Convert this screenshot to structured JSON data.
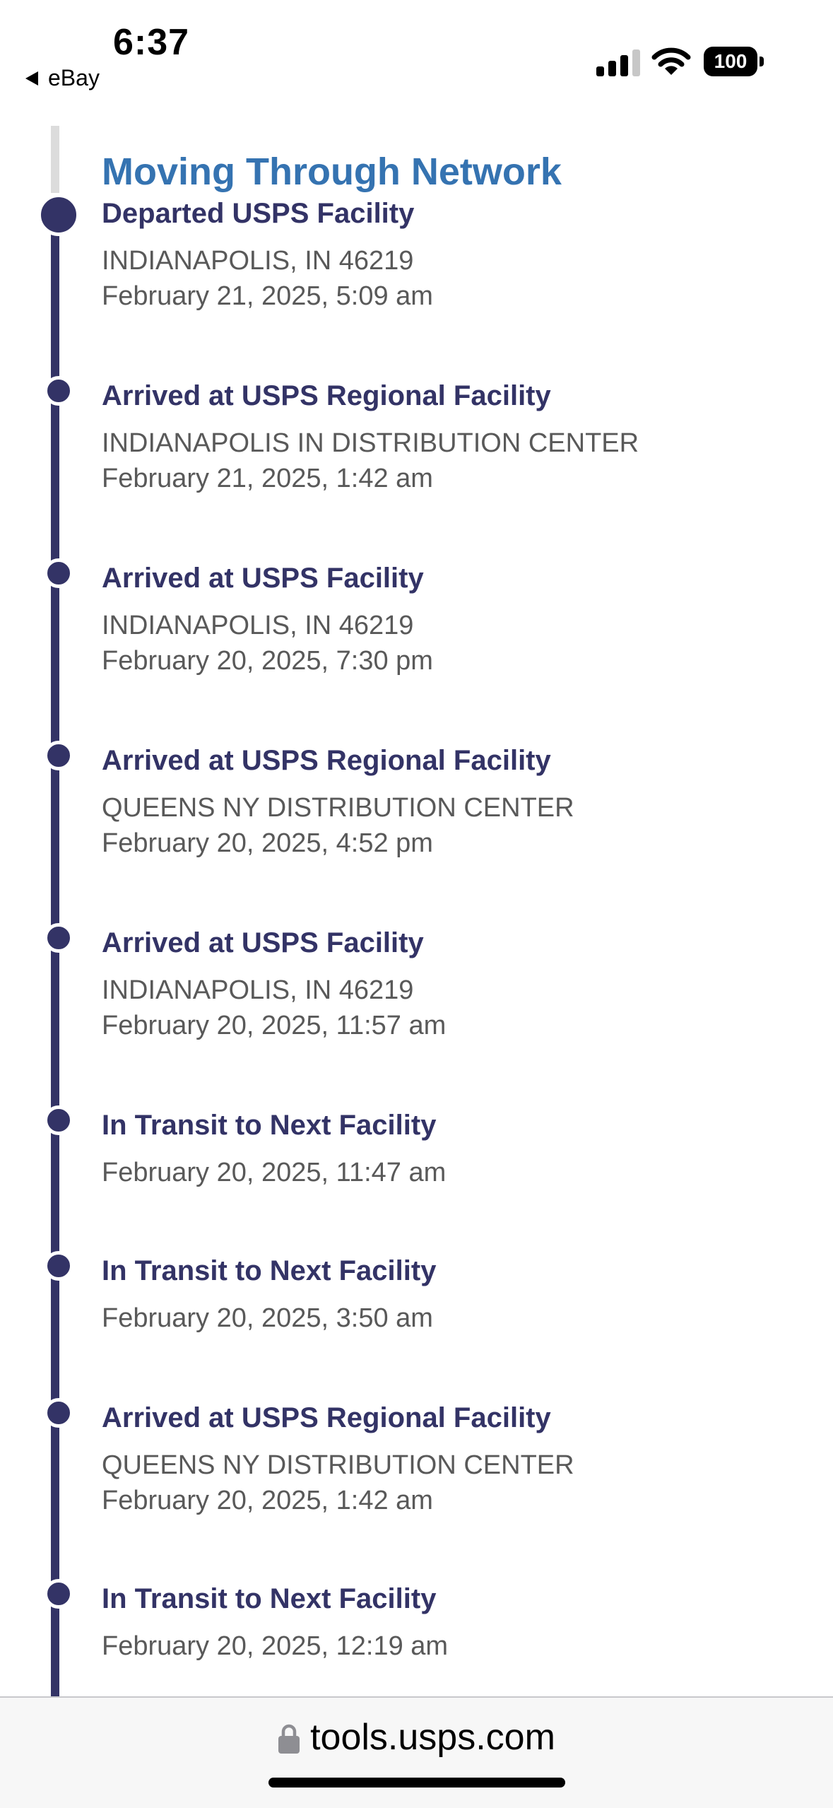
{
  "status_bar": {
    "time": "6:37",
    "back_app": "eBay",
    "battery": "100"
  },
  "tracking": {
    "section_title": "Moving Through Network",
    "events": [
      {
        "title": "Departed USPS Facility",
        "location": "INDIANAPOLIS, IN 46219",
        "date": "February 21, 2025, 5:09 am"
      },
      {
        "title": "Arrived at USPS Regional Facility",
        "location": "INDIANAPOLIS IN DISTRIBUTION CENTER",
        "date": "February 21, 2025, 1:42 am"
      },
      {
        "title": "Arrived at USPS Facility",
        "location": "INDIANAPOLIS, IN 46219",
        "date": "February 20, 2025, 7:30 pm"
      },
      {
        "title": "Arrived at USPS Regional Facility",
        "location": "QUEENS NY DISTRIBUTION CENTER",
        "date": "February 20, 2025, 4:52 pm"
      },
      {
        "title": "Arrived at USPS Facility",
        "location": "INDIANAPOLIS, IN 46219",
        "date": "February 20, 2025, 11:57 am"
      },
      {
        "title": "In Transit to Next Facility",
        "location": "",
        "date": "February 20, 2025, 11:47 am"
      },
      {
        "title": "In Transit to Next Facility",
        "location": "",
        "date": "February 20, 2025, 3:50 am"
      },
      {
        "title": "Arrived at USPS Regional Facility",
        "location": "QUEENS NY DISTRIBUTION CENTER",
        "date": "February 20, 2025, 1:42 am"
      },
      {
        "title": "In Transit to Next Facility",
        "location": "",
        "date": "February 20, 2025, 12:19 am"
      }
    ]
  },
  "browser": {
    "url": "tools.usps.com"
  },
  "colors": {
    "heading_blue": "#3573b1",
    "event_navy": "#333366",
    "body_gray": "#595959"
  }
}
